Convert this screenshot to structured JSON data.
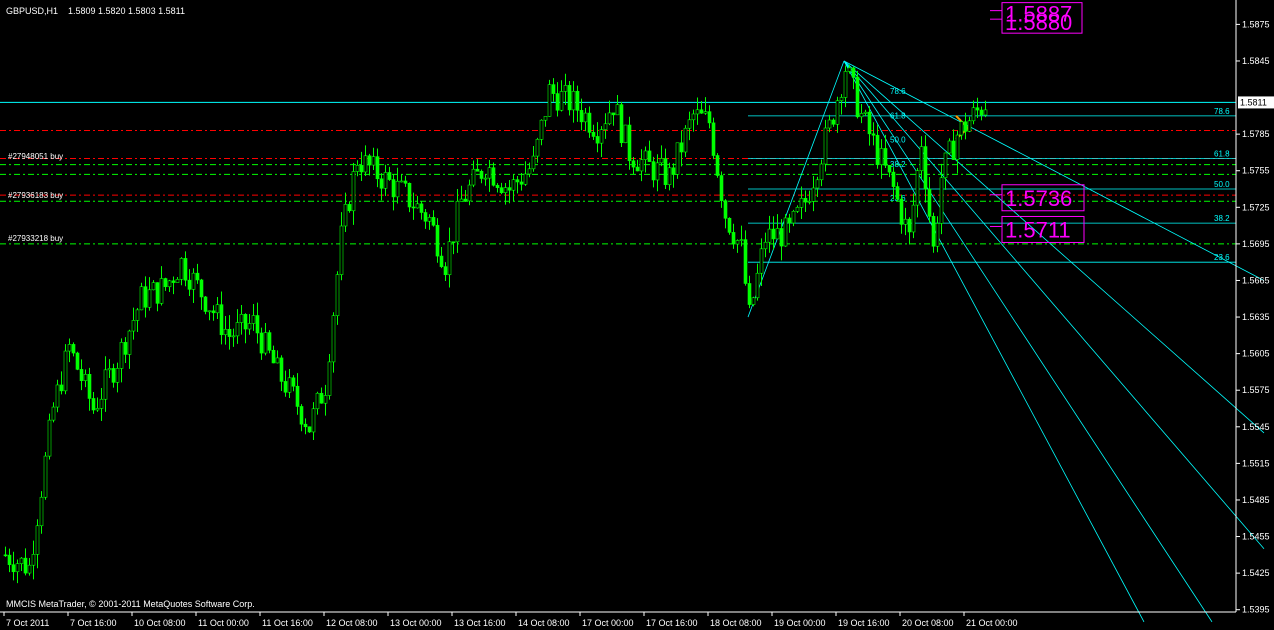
{
  "header": {
    "symbol": "GBPUSD,H1",
    "ohlc": "1.5809 1.5820 1.5803 1.5811"
  },
  "footer": {
    "copyright": "MMCIS MetaTrader, © 2001-2011 MetaQuotes Software Corp."
  },
  "colors": {
    "background": "#000000",
    "candles": "#00ff00",
    "axis_text": "#ffffff",
    "fib": "#00ffff",
    "sell_lines": "#ff0000",
    "buy_lines": "#00ff00",
    "boxes": "#ff00ff",
    "pattern": "#ff9900"
  },
  "chart_data": {
    "type": "candlestick",
    "ylim": [
      1.538,
      1.5895
    ],
    "bar_count": 315,
    "current_price": "1.5811",
    "yticks": [
      "1.5875",
      "1.5845",
      "1.5785",
      "1.5755",
      "1.5725",
      "1.5695",
      "1.5665",
      "1.5635",
      "1.5605",
      "1.5575",
      "1.5545",
      "1.5515",
      "1.5485",
      "1.5455",
      "1.5425",
      "1.5395"
    ],
    "yticks_values": [
      1.5875,
      1.5845,
      1.5785,
      1.5755,
      1.5725,
      1.5695,
      1.5665,
      1.5635,
      1.5605,
      1.5575,
      1.5545,
      1.5515,
      1.5485,
      1.5455,
      1.5425,
      1.5395
    ],
    "xticks": [
      {
        "bar": 0,
        "label": "7 Oct 2011"
      },
      {
        "bar": 16,
        "label": "7 Oct 16:00"
      },
      {
        "bar": 32,
        "label": "10 Oct 08:00"
      },
      {
        "bar": 48,
        "label": "11 Oct 00:00"
      },
      {
        "bar": 64,
        "label": "11 Oct 16:00"
      },
      {
        "bar": 80,
        "label": "12 Oct 08:00"
      },
      {
        "bar": 96,
        "label": "13 Oct 00:00"
      },
      {
        "bar": 112,
        "label": "13 Oct 16:00"
      },
      {
        "bar": 128,
        "label": "14 Oct 08:00"
      },
      {
        "bar": 144,
        "label": "17 Oct 00:00"
      },
      {
        "bar": 160,
        "label": "17 Oct 16:00"
      },
      {
        "bar": 176,
        "label": "18 Oct 08:00"
      },
      {
        "bar": 192,
        "label": "19 Oct 00:00"
      },
      {
        "bar": 208,
        "label": "19 Oct 16:00"
      },
      {
        "bar": 224,
        "label": "20 Oct 08:00"
      },
      {
        "bar": 240,
        "label": "21 Oct 00:00"
      }
    ],
    "close_path": [
      {
        "bar": 0,
        "price": 1.544
      },
      {
        "bar": 6,
        "price": 1.543
      },
      {
        "bar": 12,
        "price": 1.556
      },
      {
        "bar": 16,
        "price": 1.561
      },
      {
        "bar": 22,
        "price": 1.556
      },
      {
        "bar": 28,
        "price": 1.56
      },
      {
        "bar": 34,
        "price": 1.565
      },
      {
        "bar": 40,
        "price": 1.566
      },
      {
        "bar": 44,
        "price": 1.568
      },
      {
        "bar": 50,
        "price": 1.565
      },
      {
        "bar": 56,
        "price": 1.562
      },
      {
        "bar": 62,
        "price": 1.563
      },
      {
        "bar": 68,
        "price": 1.559
      },
      {
        "bar": 72,
        "price": 1.557
      },
      {
        "bar": 76,
        "price": 1.5545
      },
      {
        "bar": 80,
        "price": 1.558
      },
      {
        "bar": 84,
        "price": 1.57
      },
      {
        "bar": 88,
        "price": 1.5765
      },
      {
        "bar": 94,
        "price": 1.575
      },
      {
        "bar": 100,
        "price": 1.5735
      },
      {
        "bar": 106,
        "price": 1.5715
      },
      {
        "bar": 110,
        "price": 1.568
      },
      {
        "bar": 114,
        "price": 1.573
      },
      {
        "bar": 120,
        "price": 1.576
      },
      {
        "bar": 126,
        "price": 1.574
      },
      {
        "bar": 132,
        "price": 1.576
      },
      {
        "bar": 136,
        "price": 1.582
      },
      {
        "bar": 142,
        "price": 1.581
      },
      {
        "bar": 148,
        "price": 1.579
      },
      {
        "bar": 152,
        "price": 1.581
      },
      {
        "bar": 156,
        "price": 1.577
      },
      {
        "bar": 160,
        "price": 1.576
      },
      {
        "bar": 166,
        "price": 1.575
      },
      {
        "bar": 172,
        "price": 1.58
      },
      {
        "bar": 176,
        "price": 1.5795
      },
      {
        "bar": 180,
        "price": 1.572
      },
      {
        "bar": 184,
        "price": 1.569
      },
      {
        "bar": 186,
        "price": 1.5635
      },
      {
        "bar": 190,
        "price": 1.57
      },
      {
        "bar": 196,
        "price": 1.5705
      },
      {
        "bar": 200,
        "price": 1.573
      },
      {
        "bar": 206,
        "price": 1.579
      },
      {
        "bar": 210,
        "price": 1.584
      },
      {
        "bar": 214,
        "price": 1.58
      },
      {
        "bar": 218,
        "price": 1.577
      },
      {
        "bar": 222,
        "price": 1.574
      },
      {
        "bar": 226,
        "price": 1.57
      },
      {
        "bar": 229,
        "price": 1.578
      },
      {
        "bar": 232,
        "price": 1.569
      },
      {
        "bar": 234,
        "price": 1.575
      },
      {
        "bar": 238,
        "price": 1.5785
      },
      {
        "bar": 242,
        "price": 1.58
      },
      {
        "bar": 245,
        "price": 1.5811
      }
    ],
    "current_line": {
      "price": 1.5811
    },
    "sell_lines": [
      {
        "price": 1.5788
      },
      {
        "price": 1.5765
      },
      {
        "price": 1.5735
      }
    ],
    "buy_lines": [
      {
        "price": 1.576,
        "label": ""
      },
      {
        "price": 1.5752,
        "label": ""
      },
      {
        "price": 1.573,
        "label": "#27936183 buy"
      },
      {
        "price": 1.5695,
        "label": "#27933218 buy"
      }
    ],
    "buy_label_overlap": {
      "price": 1.5762,
      "label": "#27948051 buy"
    },
    "fib_retracement": {
      "start_bar": 186,
      "end_bar": 315,
      "levels": [
        {
          "level": "78.6",
          "price": 1.58
        },
        {
          "level": "61.8",
          "price": 1.5765
        },
        {
          "level": "50.0",
          "price": 1.574
        },
        {
          "level": "38.2",
          "price": 1.5712
        },
        {
          "level": "23.6",
          "price": 1.568
        }
      ]
    },
    "fib_fan": {
      "origin": {
        "bar": 210,
        "price": 1.5845
      },
      "rays": [
        {
          "bar": 315,
          "price": 1.5665
        },
        {
          "bar": 315,
          "price": 1.554
        },
        {
          "bar": 315,
          "price": 1.5445
        },
        {
          "bar": 302,
          "price": 1.5385
        },
        {
          "bar": 285,
          "price": 1.5385
        }
      ],
      "baseline": {
        "bar1": 186,
        "price1": 1.5635,
        "bar2": 210,
        "price2": 1.5845
      },
      "inner_levels": [
        {
          "level": "78.6",
          "bar": 228,
          "price": 1.5818
        },
        {
          "level": "61.8",
          "bar": 228,
          "price": 1.5798
        },
        {
          "level": "50.0",
          "bar": 228,
          "price": 1.5778
        },
        {
          "level": "38.2",
          "bar": 228,
          "price": 1.5758
        },
        {
          "level": "23.6",
          "bar": 228,
          "price": 1.573
        }
      ]
    },
    "pattern": [
      {
        "bar": 238,
        "price": 1.58
      },
      {
        "bar": 241,
        "price": 1.579
      },
      {
        "bar": 238,
        "price": 1.5781
      }
    ],
    "boxes": [
      {
        "text": "1.5887",
        "price": 1.5883
      },
      {
        "text": "1.5880",
        "price": 1.5876
      },
      {
        "text": "1.5736",
        "price": 1.5732
      },
      {
        "text": "1.5711",
        "price": 1.5706
      }
    ]
  }
}
